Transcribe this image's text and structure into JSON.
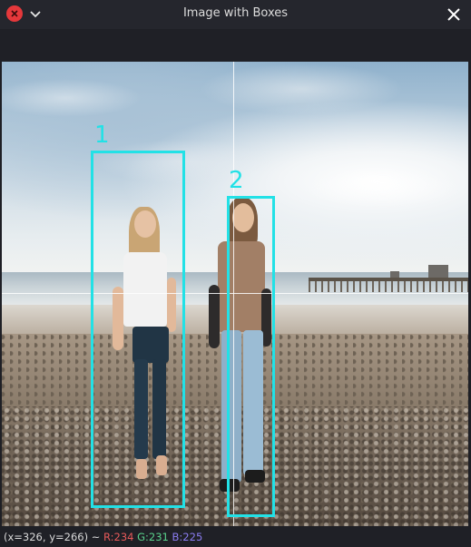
{
  "window": {
    "title": "Image with Boxes",
    "close_icon": "close-circle-icon",
    "menu_icon": "chevron-down-icon",
    "dismiss_icon": "x-icon",
    "accent_close": "#e5383b"
  },
  "image": {
    "description_icon": "beach-photo",
    "boxes": [
      {
        "label": "1",
        "color": "#22e1e6"
      },
      {
        "label": "2",
        "color": "#22e1e6"
      }
    ]
  },
  "status": {
    "coords": "(x=326, y=266) ~",
    "r": "R:234",
    "g": "G:231",
    "b": "B:225",
    "r_color": "#e85a5a",
    "g_color": "#5ad28c",
    "b_color": "#8a7cf0"
  }
}
